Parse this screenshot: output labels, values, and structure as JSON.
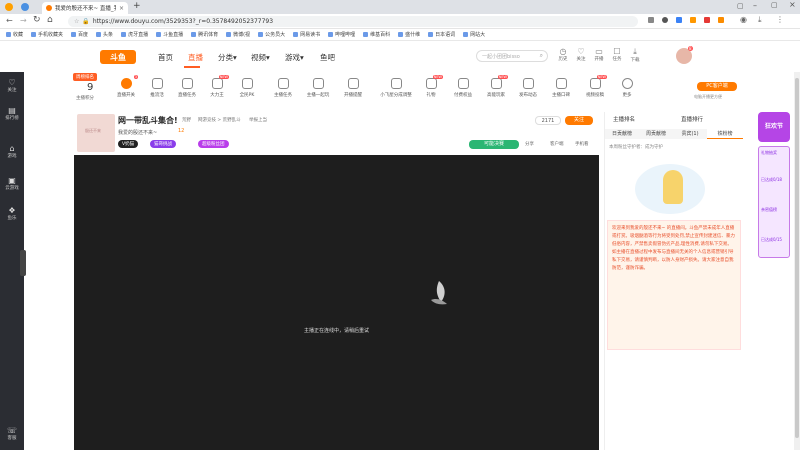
{
  "browser": {
    "tab_title": "我爱的殷还不来~ 直播_我爱的",
    "new_tab": "+",
    "url": "https://www.douyu.com/3529353?_r=0.3578492052377793",
    "nav": {
      "back": "←",
      "forward": "→",
      "reload": "↻",
      "home": "⌂"
    },
    "bookmarks": [
      "收藏",
      "手机收藏夹",
      "百度",
      "头条",
      "虎牙直播",
      "斗鱼直播",
      "腾讯体育",
      "微博(视",
      "公务员大",
      "网易读书",
      "哔哩哔哩",
      "维基百科",
      "盛什维",
      "日本语词",
      "网站大"
    ]
  },
  "site": {
    "logo": "斗鱼",
    "nav": [
      {
        "label": "首页",
        "active": false
      },
      {
        "label": "直播",
        "active": true
      },
      {
        "label": "分类▾",
        "active": false
      },
      {
        "label": "视频▾",
        "active": false
      },
      {
        "label": "游戏▾",
        "active": false
      },
      {
        "label": "鱼吧",
        "active": false
      }
    ],
    "search_placeholder": "一起小团团bisso",
    "header_icons": [
      {
        "icon": "history-icon",
        "label": "历史"
      },
      {
        "icon": "follow-icon",
        "label": "关注"
      },
      {
        "icon": "open-live-icon",
        "label": "开播"
      },
      {
        "icon": "task-icon",
        "label": "任务"
      },
      {
        "icon": "download-icon",
        "label": "下载"
      }
    ],
    "avatar_badge": "8"
  },
  "left_sidebar": [
    {
      "icon": "heart-icon",
      "label": "关注"
    },
    {
      "icon": "chart-icon",
      "label": "排行榜"
    },
    {
      "icon": "game-icon",
      "label": "游戏"
    },
    {
      "icon": "cloud-game-icon",
      "label": "云游戏"
    },
    {
      "icon": "fish-icon",
      "label": "鱼乐"
    },
    {
      "icon": "help-icon",
      "label": "客服"
    }
  ],
  "toolbar": {
    "rank_badge": "周榜排名",
    "rank_number": "9",
    "rank_label": "主播积分",
    "items": [
      {
        "label": "直播开关",
        "badge": "3"
      },
      {
        "label": "推流活",
        "badge": ""
      },
      {
        "label": "直播任务",
        "badge": ""
      },
      {
        "label": "大力王",
        "badge": "NEW"
      },
      {
        "label": "全民PK",
        "badge": ""
      },
      {
        "label": "主播任务",
        "badge": ""
      },
      {
        "label": "主播一起玩",
        "badge": ""
      },
      {
        "label": "开播提醒",
        "badge": ""
      },
      {
        "label": "小飞屋分成调整",
        "badge": ""
      },
      {
        "label": "礼物",
        "badge": "NEW"
      },
      {
        "label": "付费权益",
        "badge": ""
      },
      {
        "label": "高能玩家",
        "badge": "NEW"
      },
      {
        "label": "发布动态",
        "badge": ""
      },
      {
        "label": "主播口碑",
        "badge": ""
      },
      {
        "label": "视频投稿",
        "badge": "NEW"
      },
      {
        "label": "更多",
        "badge": ""
      }
    ],
    "pc_client_btn": "PC客户端",
    "pc_client_sub": "电脑开播更方便"
  },
  "stream_info": {
    "title": "网一带乱斗集合!",
    "category_1": "荒野",
    "category_2": "网游竞技 > 荒野乱斗",
    "category_3": "举报上当",
    "streamer_name": "我爱的殷还不来~",
    "avatar_text": "殷还不来",
    "pill_1": "V奶猫",
    "pill_2": "猫哥挑战",
    "pill_3": "超级粉丝团",
    "level_badge": "12",
    "fans": "2171",
    "follow_btn": "关注",
    "hot_value": "可能决赛",
    "share_label": "分享",
    "client_label": "客户端",
    "phone_label": "手机看"
  },
  "video": {
    "status_message": "主播正在连线中，请稍后重试"
  },
  "chat": {
    "anchor_rank": "主播排名",
    "stream_rank": "直播排行",
    "tabs": [
      "日贡献榜",
      "周贡献榜",
      "贵宾(1)",
      "铁粉榜"
    ],
    "empty_msg": "本周粉丝守护者：成为守护",
    "notice": "欢迎来到我爱的殷还不来~ 的直播间。斗鱼严禁未成年人直播或打赏。吸烟酗酒等行为将受到处罚,禁止宣传封建迷信、暴力低俗内容，严禁售卖假冒伪劣产品,理性消费,请勿私下交易。如主播在直播过程中发布与直播间无关的个人信息或营销引导私下交易，请谨慎判断，以防人身财产损失。请大家注意自我防范，谨防诈骗。"
  },
  "right_float": {
    "event": "狂欢节",
    "label_1": "礼物抽奖",
    "label_2": "已达成0/18",
    "label_3": "亲密值榜",
    "label_4": "已达成0/15"
  }
}
